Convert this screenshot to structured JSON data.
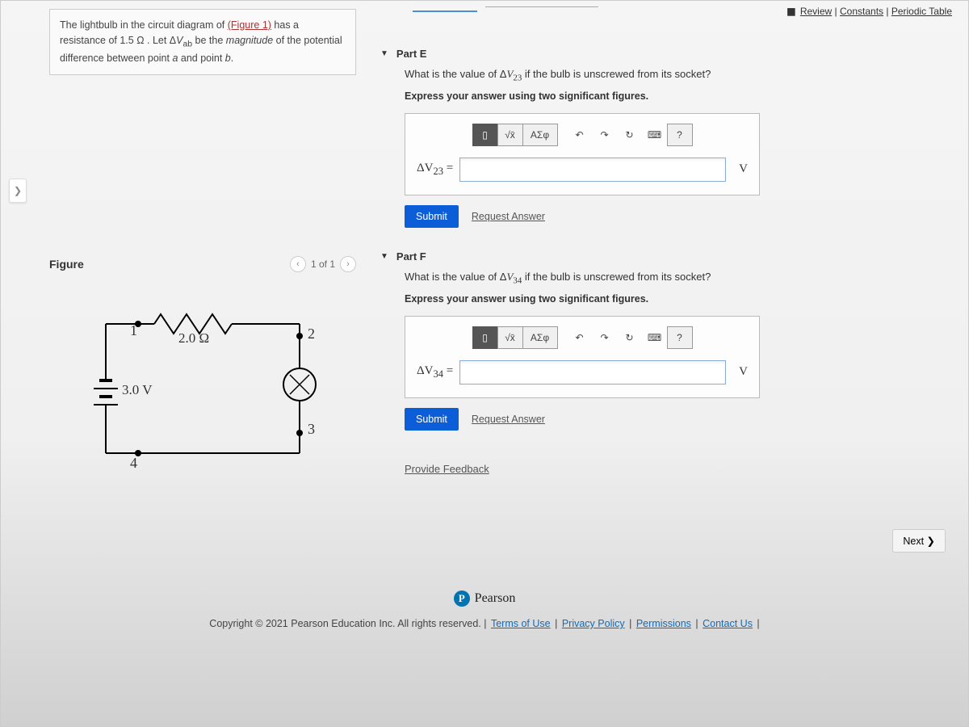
{
  "top_links": {
    "review": "Review",
    "constants": "Constants",
    "periodic": "Periodic Table"
  },
  "problem": {
    "prefix": "The lightbulb in the circuit diagram of ",
    "figure_link": "(Figure 1)",
    "mid1": " has a resistance of 1.5 Ω . Let Δ",
    "vab": "V",
    "sub_ab": "ab",
    "mid2": " be the ",
    "magnitude": "magnitude",
    "mid3": " of the potential difference between point ",
    "a": "a",
    "and": " and point ",
    "b": "b",
    "period": "."
  },
  "figure": {
    "title": "Figure",
    "page": "1 of 1",
    "resistor": "2.0 Ω",
    "voltage": "3.0 V",
    "n1": "1",
    "n2": "2",
    "n3": "3",
    "n4": "4"
  },
  "parts": {
    "e": {
      "title": "Part E",
      "q_prefix": "What is the value of Δ",
      "q_v": "V",
      "q_sub": "23",
      "q_suffix": " if the bulb is unscrewed from its socket?",
      "instruction": "Express your answer using two significant figures.",
      "var_prefix": "ΔV",
      "var_sub": "23",
      "equals": " =",
      "unit": "V"
    },
    "f": {
      "title": "Part F",
      "q_prefix": "What is the value of Δ",
      "q_v": "V",
      "q_sub": "34",
      "q_suffix": " if the bulb is unscrewed from its socket?",
      "instruction": "Express your answer using two significant figures.",
      "var_prefix": "ΔV",
      "var_sub": "34",
      "equals": " =",
      "unit": "V"
    }
  },
  "toolbar": {
    "template": "▯",
    "fraction": "√x̄",
    "greek": "ΑΣφ",
    "undo": "↶",
    "redo": "↷",
    "reset": "↻",
    "keyboard": "⌨",
    "help": "?"
  },
  "actions": {
    "submit": "Submit",
    "request": "Request Answer"
  },
  "feedback_link": "Provide Feedback",
  "next": "Next ❯",
  "pearson": {
    "badge": "P",
    "name": "Pearson"
  },
  "footer": {
    "copyright": "Copyright © 2021 Pearson Education Inc. All rights reserved.",
    "terms": "Terms of Use",
    "privacy": "Privacy Policy",
    "permissions": "Permissions",
    "contact": "Contact Us"
  }
}
